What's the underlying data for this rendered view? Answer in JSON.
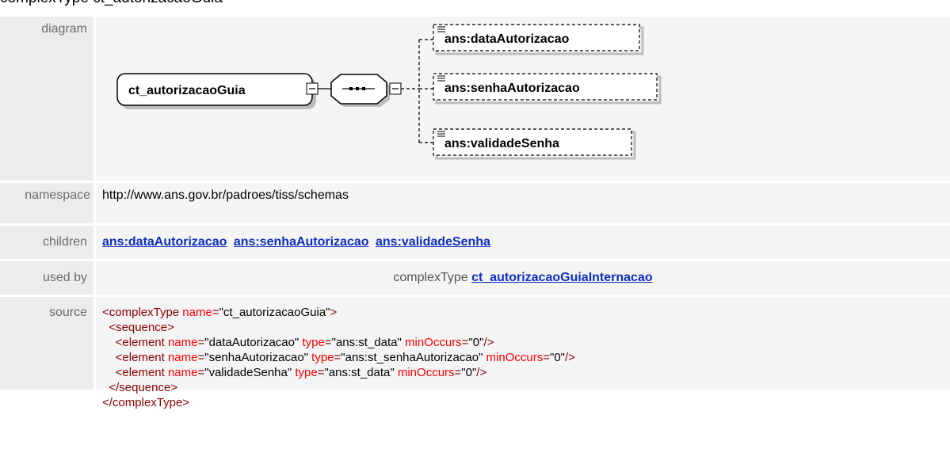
{
  "page": {
    "heading": "complexType ct_autorizacaoGuia"
  },
  "rows": {
    "diagram_label": "diagram",
    "namespace_label": "namespace",
    "children_label": "children",
    "usedby_label": "used by",
    "source_label": "source"
  },
  "diagram": {
    "root_label": "ct_autorizacaoGuia",
    "elements": [
      {
        "label": "ans:dataAutorizacao"
      },
      {
        "label": "ans:senhaAutorizacao"
      },
      {
        "label": "ans:validadeSenha"
      }
    ]
  },
  "namespace": {
    "value": "http://www.ans.gov.br/padroes/tiss/schemas"
  },
  "children": [
    {
      "label": "ans:dataAutorizacao"
    },
    {
      "label": "ans:senhaAutorizacao"
    },
    {
      "label": "ans:validadeSenha"
    }
  ],
  "used_by": {
    "kind": "complexType",
    "link": "ct_autorizacaoGuiaInternacao"
  },
  "source": {
    "l1_open": "<complexType",
    "l1_name_attr": " name",
    "l1_eq": "=",
    "l1_name_val": "\"ct_autorizacaoGuia\"",
    "l1_close": ">",
    "l2": "  <sequence>",
    "elements": [
      {
        "open": "    <element",
        "a1": " name",
        "v1": "\"dataAutorizacao\"",
        "a2": " type",
        "v2": "\"ans:st_data\"",
        "a3": " minOccurs",
        "v3": "\"0\"",
        "close": "/>"
      },
      {
        "open": "    <element",
        "a1": " name",
        "v1": "\"senhaAutorizacao\"",
        "a2": " type",
        "v2": "\"ans:st_senhaAutorizacao\"",
        "a3": " minOccurs",
        "v3": "\"0\"",
        "close": "/>"
      },
      {
        "open": "    <element",
        "a1": " name",
        "v1": "\"validadeSenha\"",
        "a2": " type",
        "v2": "\"ans:st_data\"",
        "a3": " minOccurs",
        "v3": "\"0\"",
        "close": "/>"
      }
    ],
    "l6": "  </sequence>",
    "l7": "</complexType>"
  },
  "colors": {
    "label_bg": "#ececec",
    "value_bg": "#f5f5f5",
    "link": "#0d2ec0",
    "xml_tag": "#8b0000",
    "xml_attr": "#ff0000"
  }
}
